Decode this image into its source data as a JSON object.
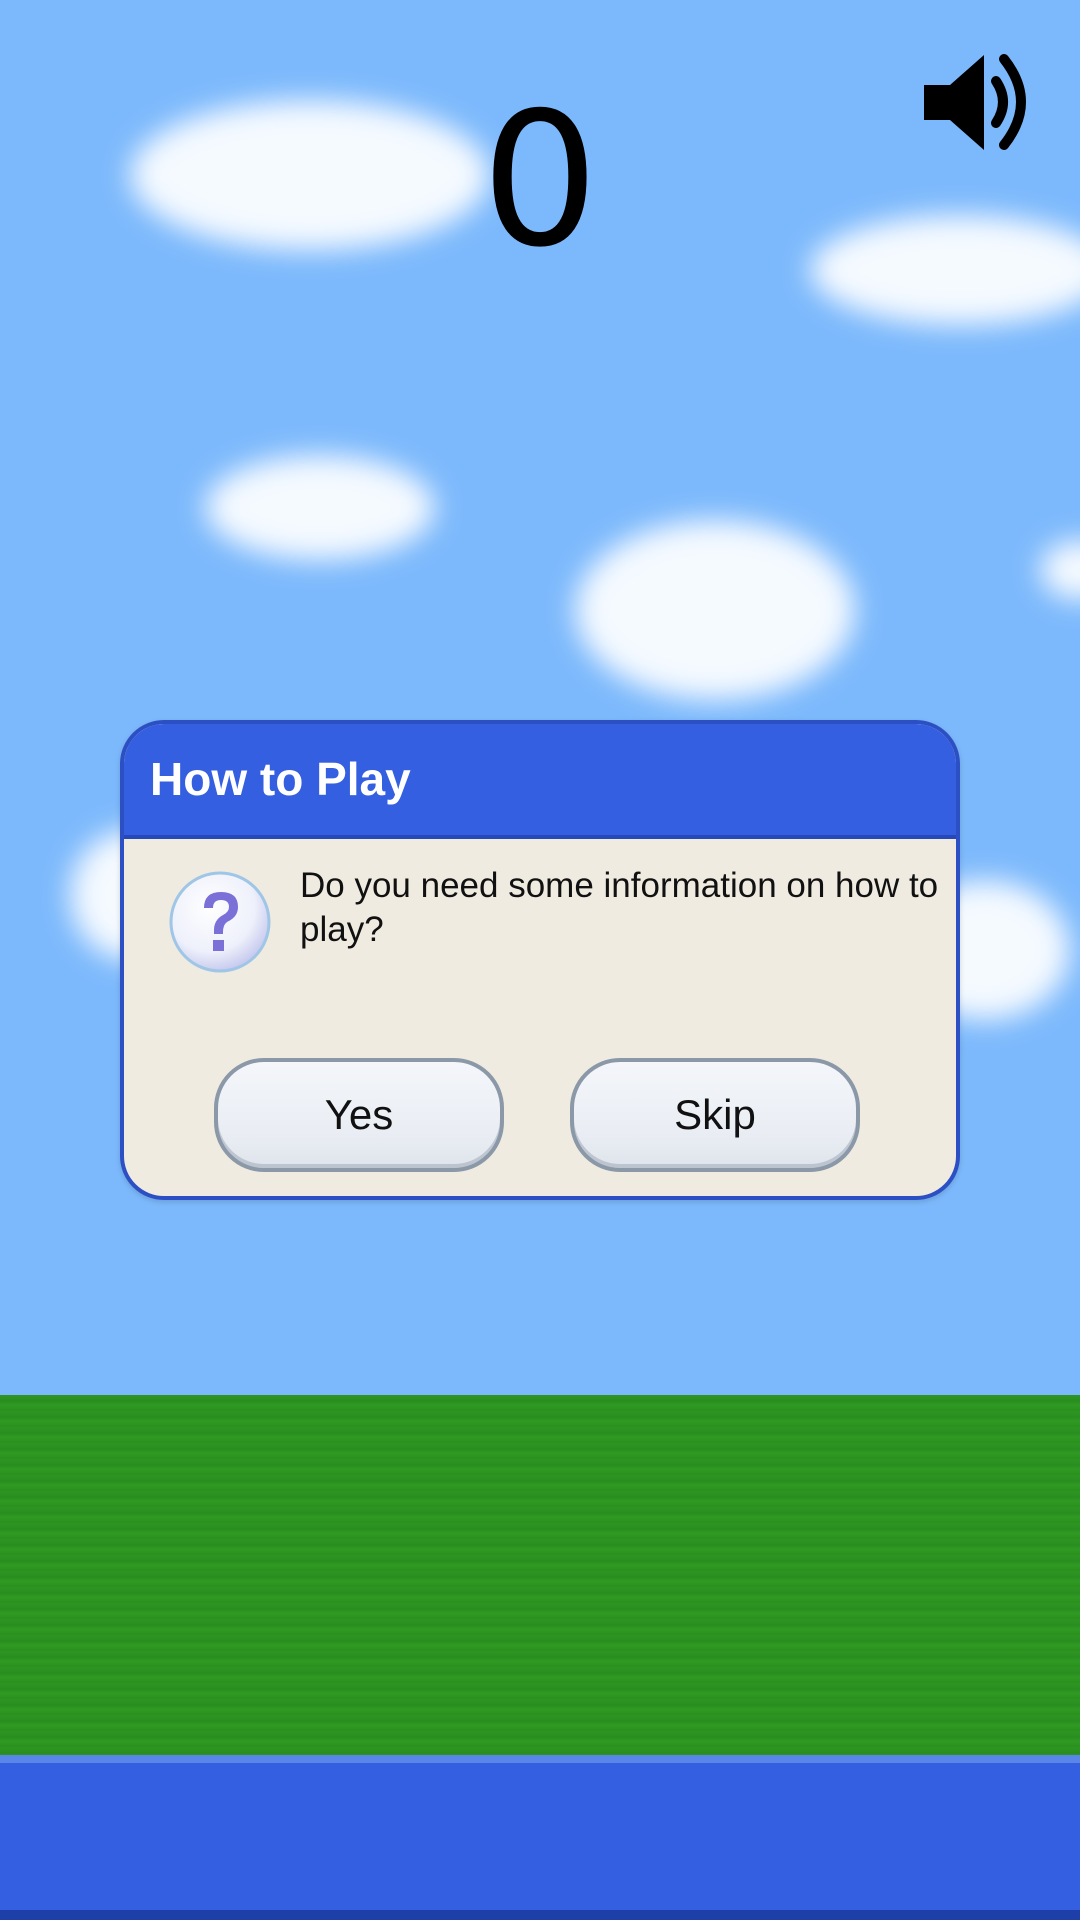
{
  "score": "0",
  "sound": {
    "icon": "speaker-on-icon"
  },
  "dialog": {
    "title": "How to Play",
    "message": "Do you need some information on how to play?",
    "icon": "question-icon",
    "yes_label": "Yes",
    "skip_label": "Skip"
  },
  "colors": {
    "sky": "#7cb9fc",
    "grass": "#2d9621",
    "ground_strip": "#335fe0",
    "dialog_header": "#335fe0",
    "dialog_body": "#efebe1"
  }
}
